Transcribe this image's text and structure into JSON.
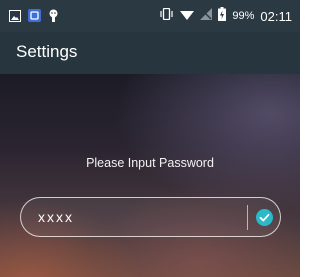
{
  "status_bar": {
    "left_icons": [
      "image-icon",
      "app-store-icon",
      "android-debug-icon"
    ],
    "right_icons": [
      "vibrate-icon",
      "wifi-icon",
      "no-sim-icon",
      "battery-icon"
    ],
    "battery_percent": "99%",
    "time": "02:11"
  },
  "app_bar": {
    "title": "Settings"
  },
  "password_dialog": {
    "prompt": "Please Input Password",
    "value": "xxxx",
    "confirm_icon": "check-icon",
    "accent_color": "#2bb9c9"
  }
}
